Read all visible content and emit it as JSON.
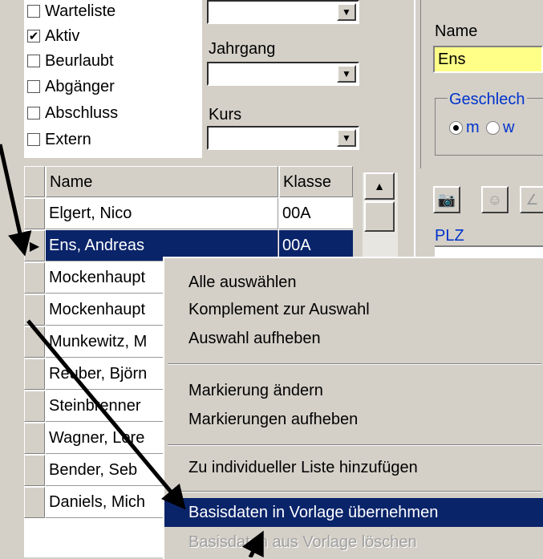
{
  "status_filters": [
    {
      "label": "Warteliste",
      "checked": false
    },
    {
      "label": "Aktiv",
      "checked": true
    },
    {
      "label": "Beurlaubt",
      "checked": false
    },
    {
      "label": "Abgänger",
      "checked": false
    },
    {
      "label": "Abschluss",
      "checked": false
    },
    {
      "label": "Extern",
      "checked": false
    }
  ],
  "filters": {
    "jahrgang_label": "Jahrgang",
    "kurs_label": "Kurs"
  },
  "grid": {
    "col_name": "Name",
    "col_class": "Klasse",
    "rows": [
      {
        "name": "Elgert, Nico",
        "klasse": "00A"
      },
      {
        "name": "Ens, Andreas",
        "klasse": "00A"
      },
      {
        "name": "Mockenhaupt",
        "klasse": ""
      },
      {
        "name": "Mockenhaupt",
        "klasse": ""
      },
      {
        "name": "Munkewitz, M",
        "klasse": ""
      },
      {
        "name": "Reuber, Björn",
        "klasse": ""
      },
      {
        "name": "Steinbrenner",
        "klasse": ""
      },
      {
        "name": "Wagner, Lore",
        "klasse": ""
      },
      {
        "name": "Bender, Seb",
        "klasse": ""
      },
      {
        "name": "Daniels, Mich",
        "klasse": ""
      }
    ],
    "selected_index": 1
  },
  "details": {
    "name_label": "Name",
    "name_value": "Ens",
    "gender_group": "Geschlech",
    "gender_m": "m",
    "gender_w": "w",
    "plz_label": "PLZ"
  },
  "context_menu": {
    "items": [
      {
        "label": "Alle auswählen"
      },
      {
        "label": "Komplement zur Auswahl"
      },
      {
        "label": "Auswahl aufheben"
      },
      {
        "label": "Markierung ändern"
      },
      {
        "label": "Markierungen aufheben"
      },
      {
        "label": "Zu individueller Liste hinzufügen"
      },
      {
        "label": "Basisdaten in Vorlage übernehmen"
      },
      {
        "label": "Basisdaten aus Vorlage löschen"
      }
    ]
  },
  "colors": {
    "selection": "#0a246a",
    "name_field": "#ffff88",
    "annotation_arrow": "#000000"
  }
}
